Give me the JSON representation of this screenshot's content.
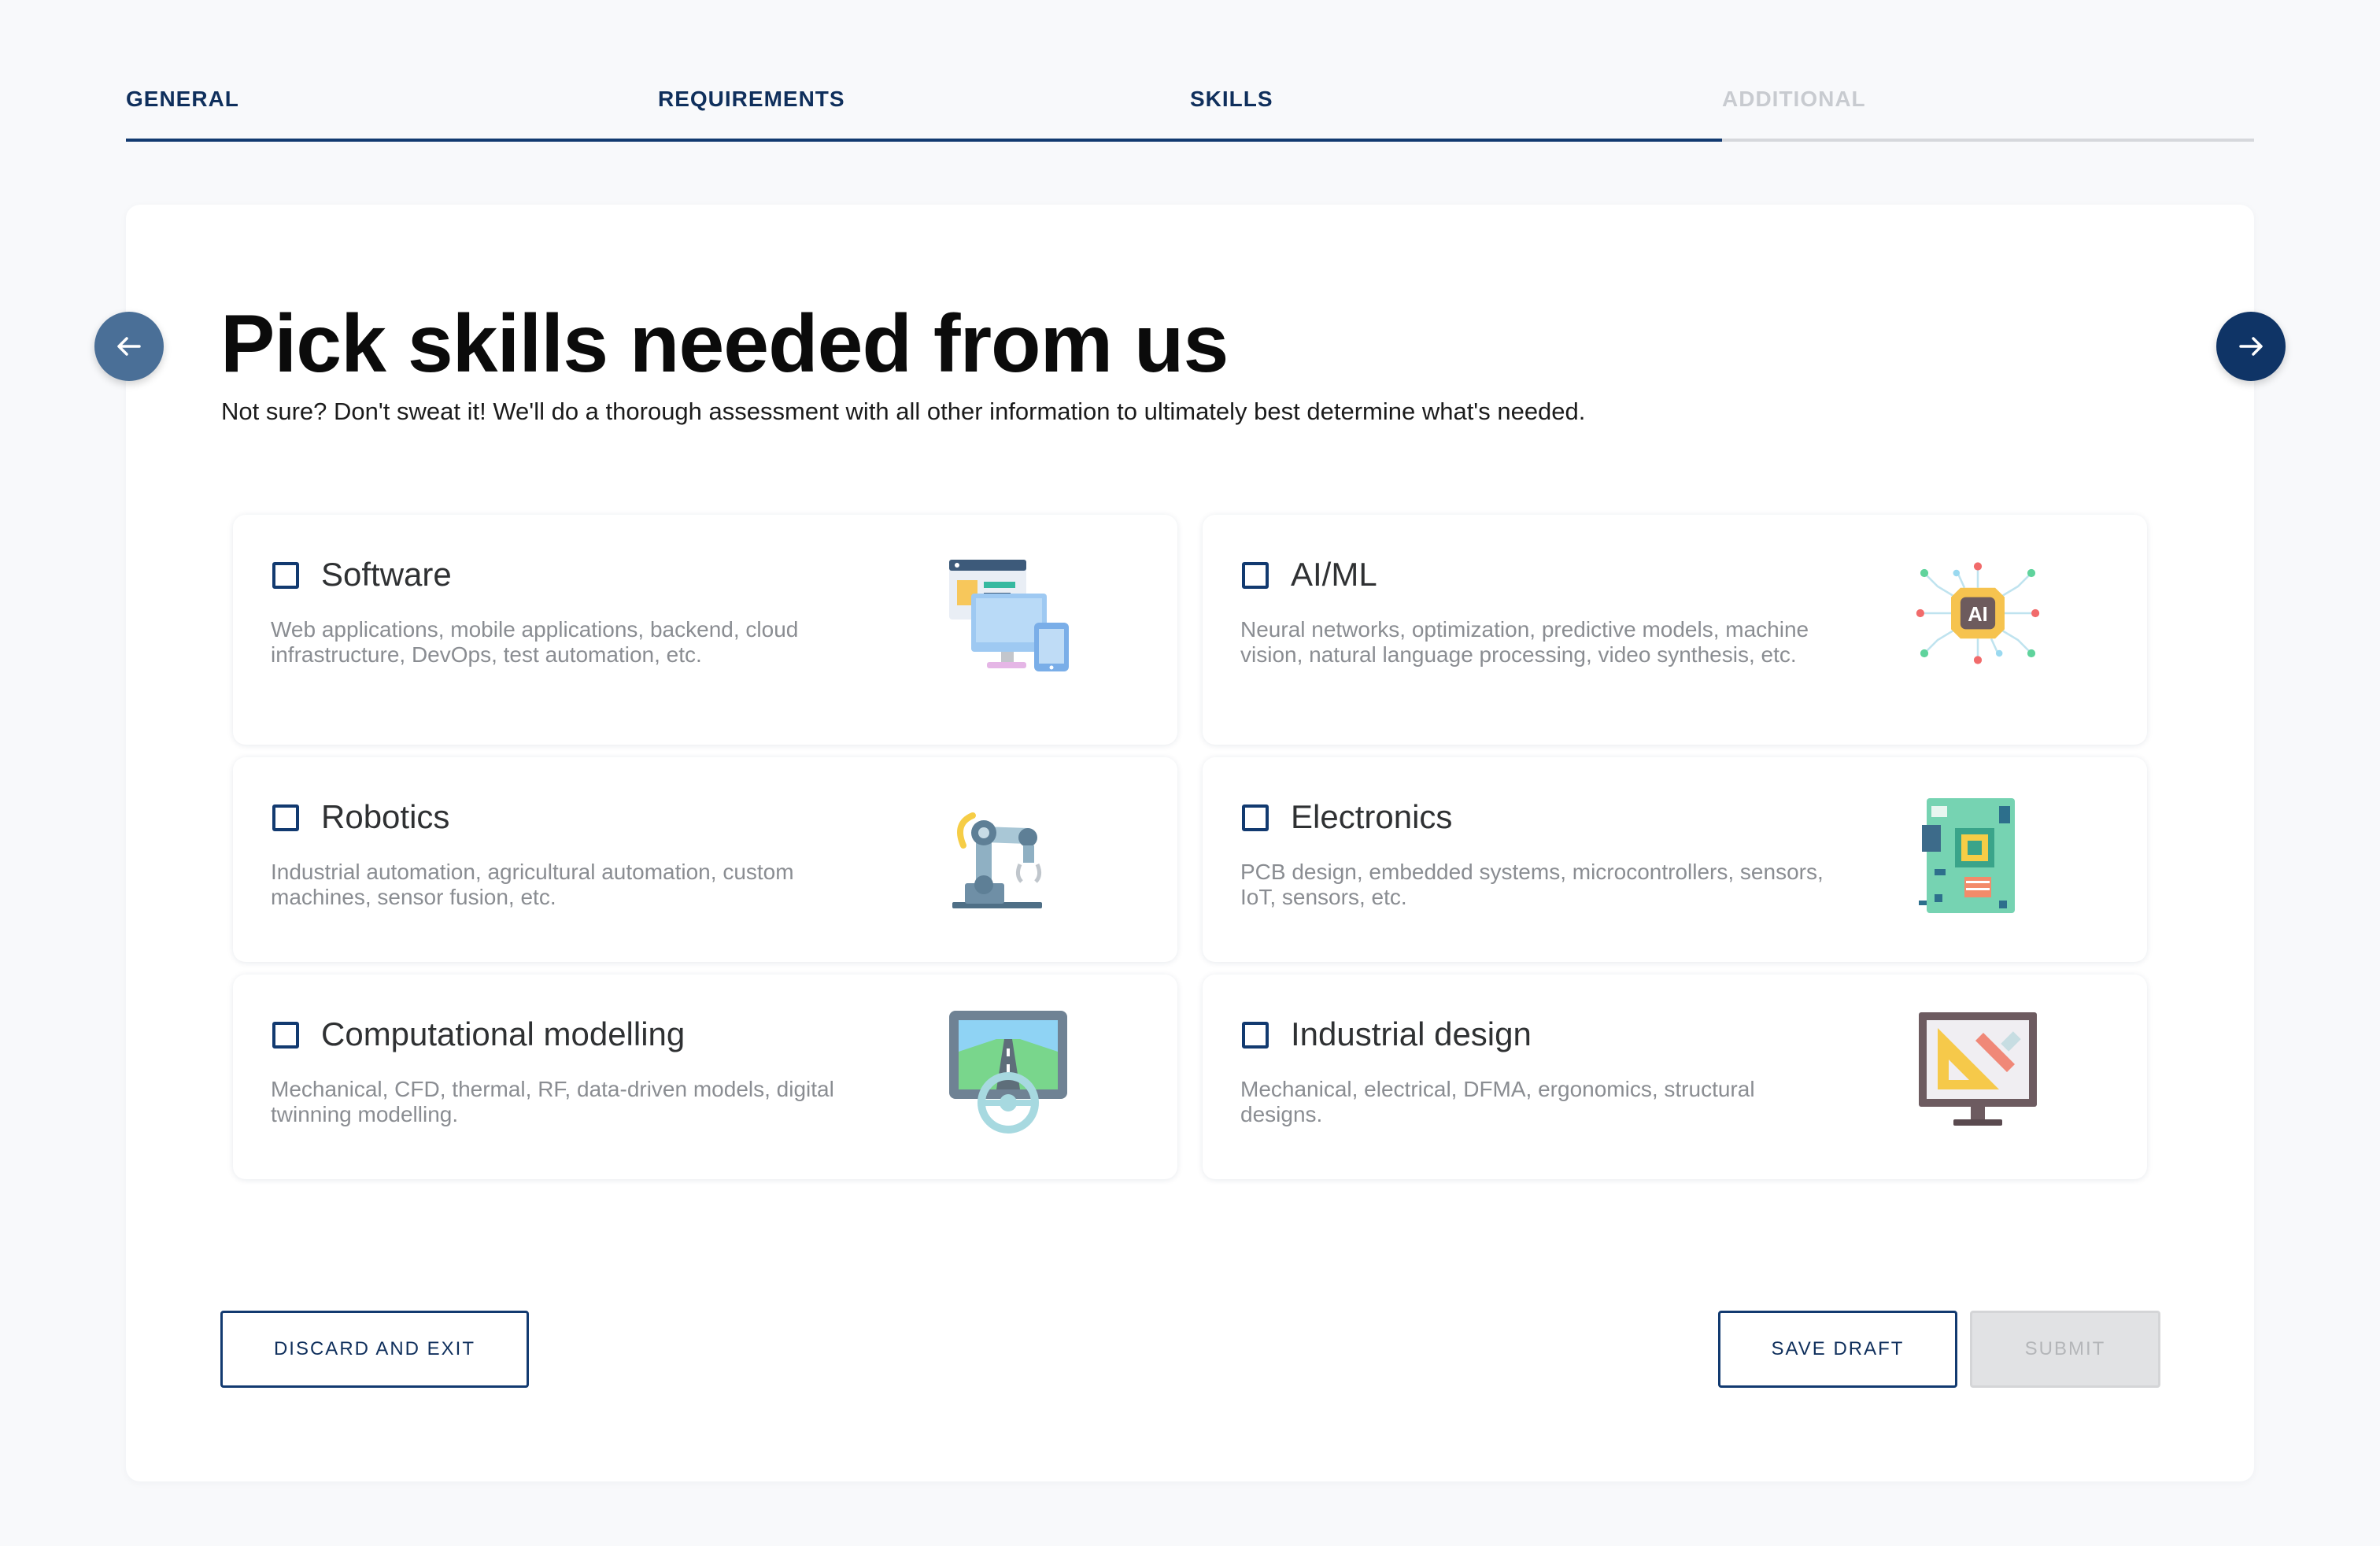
{
  "stepper": {
    "steps": [
      {
        "label": "GENERAL",
        "state": "complete"
      },
      {
        "label": "REQUIREMENTS",
        "state": "complete"
      },
      {
        "label": "SKILLS",
        "state": "current"
      },
      {
        "label": "ADDITIONAL",
        "state": "upcoming"
      }
    ]
  },
  "page": {
    "title": "Pick skills needed from us",
    "subtitle": "Not sure? Don't sweat it! We'll do a thorough assessment with all other information to ultimately best determine what's needed."
  },
  "skills": [
    {
      "name": "Software",
      "description": "Web applications, mobile applications, backend, cloud infrastructure, DevOps, test automation, etc.",
      "checked": false,
      "icon": "software-screens-icon"
    },
    {
      "name": "AI/ML",
      "description": "Neural networks, optimization, predictive models, machine vision, natural language processing, video synthesis, etc.",
      "checked": false,
      "icon": "ai-chip-icon",
      "icon_text": "AI"
    },
    {
      "name": "Robotics",
      "description": "Industrial automation, agricultural automation, custom machines, sensor fusion, etc.",
      "checked": false,
      "icon": "robot-arm-icon"
    },
    {
      "name": "Electronics",
      "description": "PCB design, embedded systems, microcontrollers, sensors, IoT, sensors, etc.",
      "checked": false,
      "icon": "circuit-board-icon"
    },
    {
      "name": "Computational modelling",
      "description": "Mechanical, CFD, thermal, RF, data-driven models, digital twinning modelling.",
      "checked": false,
      "icon": "driving-simulator-icon"
    },
    {
      "name": "Industrial design",
      "description": "Mechanical, electrical, DFMA, ergonomics, structural designs.",
      "checked": false,
      "icon": "design-monitor-icon"
    }
  ],
  "actions": {
    "discard_label": "DISCARD AND EXIT",
    "save_label": "SAVE DRAFT",
    "submit_label": "SUBMIT",
    "submit_enabled": false
  },
  "colors": {
    "primary": "#123a70",
    "prev_button": "#4a6f97",
    "inactive_step": "#c8cbd0",
    "disabled_button": "#e1e2e4"
  }
}
